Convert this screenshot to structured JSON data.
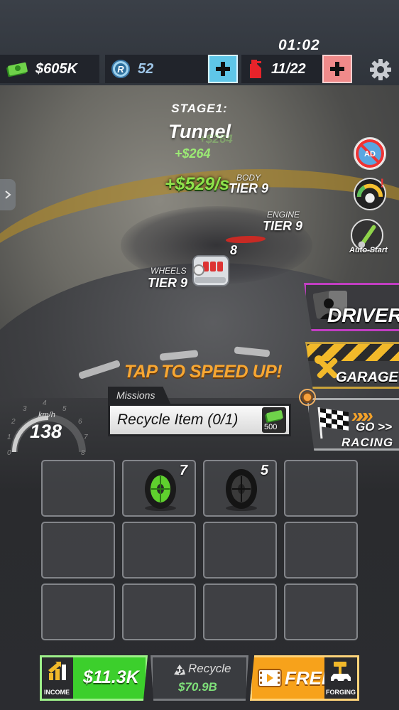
{
  "top_bar": {
    "timer": "01:02",
    "cash": "$605K",
    "premium": "52",
    "fuel": "11/22"
  },
  "stage": {
    "label": "STAGE1:",
    "name": "Tunnel",
    "float_earning_faded": "+$264",
    "float_earning": "+$264",
    "income_rate": "+$529/s"
  },
  "car_parts": [
    {
      "part": "BODY",
      "tier": "TIER 9"
    },
    {
      "part": "ENGINE",
      "tier": "TIER 9"
    },
    {
      "part": "WHEELS",
      "tier": "TIER 9"
    }
  ],
  "engine_level": "8",
  "side_buttons": {
    "no_ads_icon": "no-ads-icon",
    "boost_icon": "gauge-alert-icon",
    "auto_start_label": "Auto-Start"
  },
  "menu": {
    "driver_label": "DRIVER",
    "garage_label": "GARAGE",
    "go_label": "GO >>",
    "racing_label": "RACING"
  },
  "tap_hint": "TAP TO SPEED UP!",
  "missions": {
    "tab_label": "Missions",
    "text": "Recycle Item (0/1)",
    "reward": "500"
  },
  "speedometer": {
    "unit": "km/h",
    "speed": "138",
    "ticks": [
      "0",
      "1",
      "2",
      "3",
      "4",
      "5",
      "6",
      "7",
      "8"
    ]
  },
  "inventory": {
    "slots": [
      {
        "item": "",
        "level": ""
      },
      {
        "item": "green-wheel",
        "level": "7"
      },
      {
        "item": "black-wheel",
        "level": "5"
      },
      {
        "item": "",
        "level": ""
      },
      {
        "item": "",
        "level": ""
      },
      {
        "item": "",
        "level": ""
      },
      {
        "item": "",
        "level": ""
      },
      {
        "item": "",
        "level": ""
      },
      {
        "item": "",
        "level": ""
      },
      {
        "item": "",
        "level": ""
      },
      {
        "item": "",
        "level": ""
      },
      {
        "item": "",
        "level": ""
      }
    ]
  },
  "bottom_bar": {
    "income_label": "INCOME",
    "income_value": "$11.3K",
    "recycle_label": "Recycle",
    "recycle_value": "$70.9B",
    "free_label": "FREE",
    "forging_label": "FORGING"
  },
  "colors": {
    "income_green": "#3ccf2c",
    "free_orange": "#f7a21b",
    "driver_purple": "#c13ec2",
    "cash_plus_bg": "#5fc6e8",
    "fuel_plus_bg": "#f08a8a",
    "tap_orange": "#f7a733"
  }
}
